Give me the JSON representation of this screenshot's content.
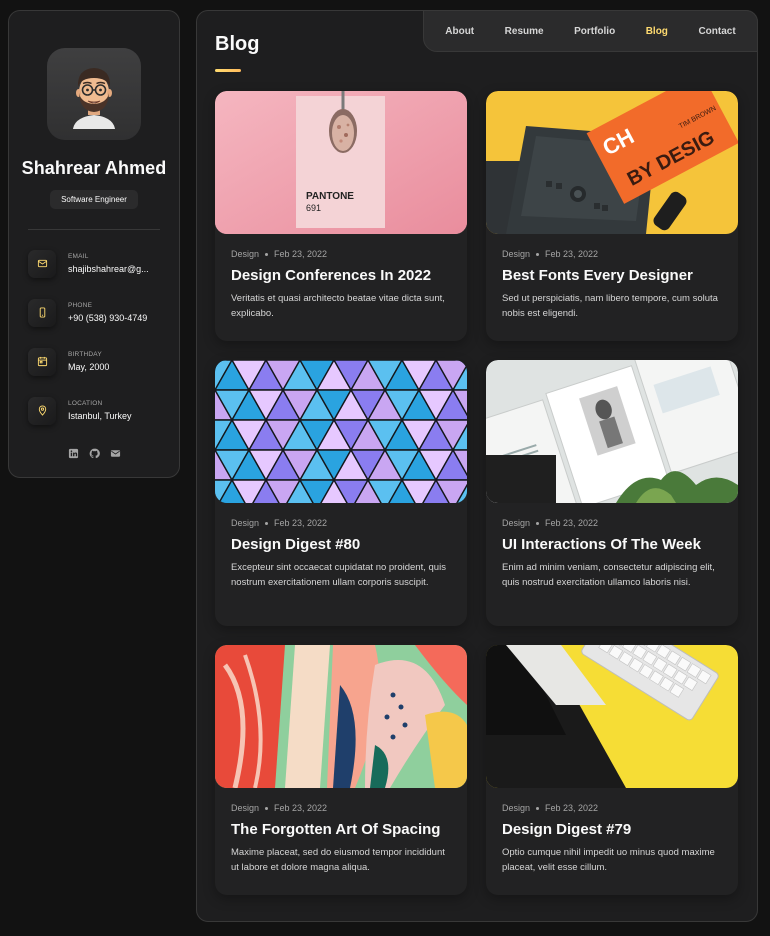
{
  "profile": {
    "name": "Shahrear Ahmed",
    "title": "Software Engineer"
  },
  "contacts": [
    {
      "label": "EMAIL",
      "value": "shajibshahrear@g...",
      "icon": "mail-icon"
    },
    {
      "label": "PHONE",
      "value": "+90 (538) 930-4749",
      "icon": "phone-icon"
    },
    {
      "label": "BIRTHDAY",
      "value": "May, 2000",
      "icon": "calendar-icon"
    },
    {
      "label": "LOCATION",
      "value": "Istanbul, Turkey",
      "icon": "location-pin-icon"
    }
  ],
  "socials": [
    "linkedin-icon",
    "github-icon",
    "mail-icon"
  ],
  "nav": {
    "items": [
      "About",
      "Resume",
      "Portfolio",
      "Blog",
      "Contact"
    ],
    "active": "Blog"
  },
  "page": {
    "title": "Blog"
  },
  "posts": [
    {
      "category": "Design",
      "date": "Feb 23, 2022",
      "title": "Design Conferences In 2022",
      "excerpt": "Veritatis et quasi architecto beatae vitae dicta sunt, explicabo.",
      "image_text_1": "PANTONE",
      "image_text_2": "691"
    },
    {
      "category": "Design",
      "date": "Feb 23, 2022",
      "title": "Best Fonts Every Designer",
      "excerpt": "Sed ut perspiciatis, nam libero tempore, cum soluta nobis est eligendi.",
      "image_text_1": "CH",
      "image_text_2": "BY DESIG",
      "image_text_3": "TIM BROWN"
    },
    {
      "category": "Design",
      "date": "Feb 23, 2022",
      "title": "Design Digest #80",
      "excerpt": "Excepteur sint occaecat cupidatat no proident, quis nostrum exercitationem ullam corporis suscipit."
    },
    {
      "category": "Design",
      "date": "Feb 23, 2022",
      "title": "UI Interactions Of The Week",
      "excerpt": "Enim ad minim veniam, consectetur adipiscing elit, quis nostrud exercitation ullamco laboris nisi."
    },
    {
      "category": "Design",
      "date": "Feb 23, 2022",
      "title": "The Forgotten Art Of Spacing",
      "excerpt": "Maxime placeat, sed do eiusmod tempor incididunt ut labore et dolore magna aliqua."
    },
    {
      "category": "Design",
      "date": "Feb 23, 2022",
      "title": "Design Digest #79",
      "excerpt": "Optio cumque nihil impedit uo minus quod maxime placeat, velit esse cillum."
    }
  ],
  "colors": {
    "accent": "#ffdb70",
    "background": "#121212",
    "panel": "#1e1e1f",
    "card": "#222223"
  }
}
